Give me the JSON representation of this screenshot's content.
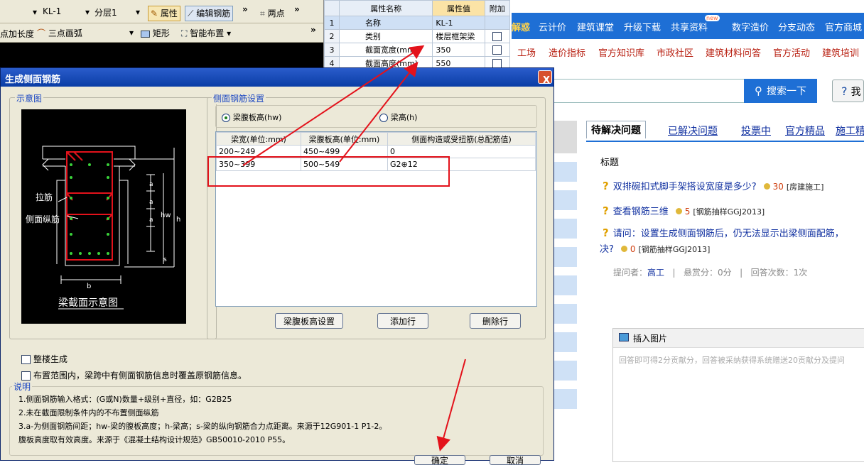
{
  "toolbar": {
    "element_select": "KL-1",
    "floor_select": "分层1",
    "property_btn": "属性",
    "edit_rebar_btn": "编辑钢筋",
    "more": "»",
    "two_point": "两点",
    "add_length": "点加长度",
    "three_point_arc": "三点画弧",
    "rectangle": "矩形",
    "smart_layout": "智能布置"
  },
  "property_table": {
    "headers": [
      "属性名称",
      "属性值",
      "附加"
    ],
    "rows": [
      {
        "idx": "1",
        "name": "名称",
        "value": "KL-1"
      },
      {
        "idx": "2",
        "name": "类别",
        "value": "楼层框架梁"
      },
      {
        "idx": "3",
        "name": "截面宽度(mm)",
        "value": "350"
      },
      {
        "idx": "4",
        "name": "截面高度(mm)",
        "value": "550"
      }
    ]
  },
  "web": {
    "nav": [
      "解惑",
      "云计价",
      "建筑课堂",
      "升级下载",
      "共享资料",
      "数字造价",
      "分支动态",
      "官方商城"
    ],
    "new_badge": "new",
    "subnav": [
      "工场",
      "造价指标",
      "官方知识库",
      "市政社区",
      "建筑材料问答",
      "官方活动",
      "建筑培训"
    ],
    "search_button": "搜索一下",
    "help_button": "我",
    "tabs": [
      "待解决问题",
      "已解决问题",
      "投票中",
      "官方精品",
      "施工精品"
    ],
    "title_label": "标题",
    "questions": [
      {
        "title": "双排碗扣式脚手架搭设宽度是多少?",
        "points": "30",
        "category": "[房建施工]"
      },
      {
        "title": "查看钢筋三维",
        "points": "5",
        "category": "[钢筋抽样GGJ2013]"
      },
      {
        "title": "请问：设置生成侧面钢筋后，仍无法显示出梁侧面配筋，",
        "title2": "决?",
        "points": "0",
        "category": "[钢筋抽样GGJ2013]"
      }
    ],
    "meta": {
      "asker_label": "提问者：",
      "asker": "高工",
      "reward": "悬赏分：0分",
      "answers": "回答次数：1次",
      "sep": "|"
    },
    "insert_image": "插入图片",
    "answer_placeholder": "回答即可得2分贡献分，回答被采纳获得系统赠送20贡献分及提问"
  },
  "dialog": {
    "title": "生成侧面钢筋",
    "close": "X",
    "diagram_group": "示意图",
    "settings_group": "侧面钢筋设置",
    "radio_hw": "梁腹板高(hw)",
    "radio_h": "梁高(h)",
    "diagram": {
      "tie": "拉筋",
      "side_rebar": "侧面纵筋",
      "caption": "梁截面示意图",
      "a": "a",
      "s": "s",
      "hw": "hw",
      "h": "h",
      "b": "b"
    },
    "grid": {
      "headers": [
        "梁宽(单位:mm)",
        "梁腹板高(单位:mm)",
        "侧面构造或受扭筋(总配筋值)"
      ],
      "rows": [
        [
          "200~249",
          "450~499",
          "0"
        ],
        [
          "350~399",
          "500~549",
          "G2⊕12"
        ]
      ]
    },
    "btn_web_height": "梁腹板高设置",
    "btn_add_row": "添加行",
    "btn_delete_row": "删除行",
    "chk_whole_floor": "整楼生成",
    "chk_overwrite": "布置范围内，梁跨中有侧面钢筋信息时覆盖原钢筋信息。",
    "notes_label": "说明",
    "notes": [
      "1.侧面钢筋输入格式：(G或N)数量+级别+直径，如：G2B25",
      "2.未在截面限制条件内的不布置侧面纵筋",
      "3.a-为侧面钢筋间距；hw-梁的腹板高度；h-梁高；s-梁的纵向钢筋合力点距离。来源于12G901-1 P1-2。",
      "  腹板高度取有效高度。来源于《混凝土结构设计规范》GB50010-2010 P55。"
    ],
    "ok": "确定",
    "cancel": "取消"
  },
  "colors": {
    "annotation": "#e3121b",
    "title_bar": "#0a3da5",
    "web_blue": "#1e6fd5"
  }
}
